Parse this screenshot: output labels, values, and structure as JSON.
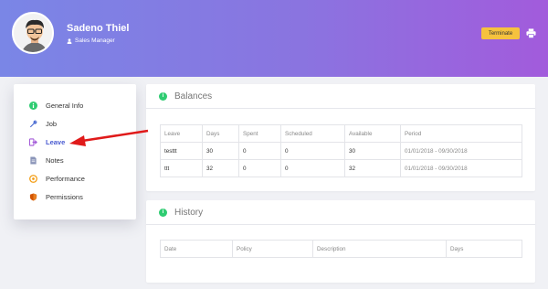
{
  "employee": {
    "name": "Sadeno Thiel",
    "role": "Sales Manager"
  },
  "actions": {
    "terminate_label": "Terminate",
    "print_icon": "print-icon"
  },
  "sidebar": {
    "items": [
      {
        "label": "General Info",
        "icon": "info-icon",
        "color": "#2ecc71"
      },
      {
        "label": "Job",
        "icon": "wrench-icon",
        "color": "#4a6bd1"
      },
      {
        "label": "Leave",
        "icon": "leave-icon",
        "color": "#a35ad8",
        "active": true
      },
      {
        "label": "Notes",
        "icon": "note-icon",
        "color": "#8a94b8"
      },
      {
        "label": "Performance",
        "icon": "performance-icon",
        "color": "#f39c12"
      },
      {
        "label": "Permissions",
        "icon": "shield-icon",
        "color": "#d35400"
      }
    ]
  },
  "balances": {
    "title": "Balances",
    "columns": [
      "Leave",
      "Days",
      "Spent",
      "Scheduled",
      "Available",
      "Period"
    ],
    "rows": [
      [
        "testtt",
        "30",
        "0",
        "0",
        "30",
        "01/01/2018 - 09/30/2018"
      ],
      [
        "ttt",
        "32",
        "0",
        "0",
        "32",
        "01/01/2018 - 09/30/2018"
      ]
    ]
  },
  "history": {
    "title": "History",
    "columns": [
      "Date",
      "Policy",
      "Description",
      "Days"
    ]
  },
  "colors": {
    "accent": "#4a5bd1",
    "terminate": "#f6c23e",
    "success": "#2ecc71",
    "annotation_arrow": "#e01a1a"
  }
}
